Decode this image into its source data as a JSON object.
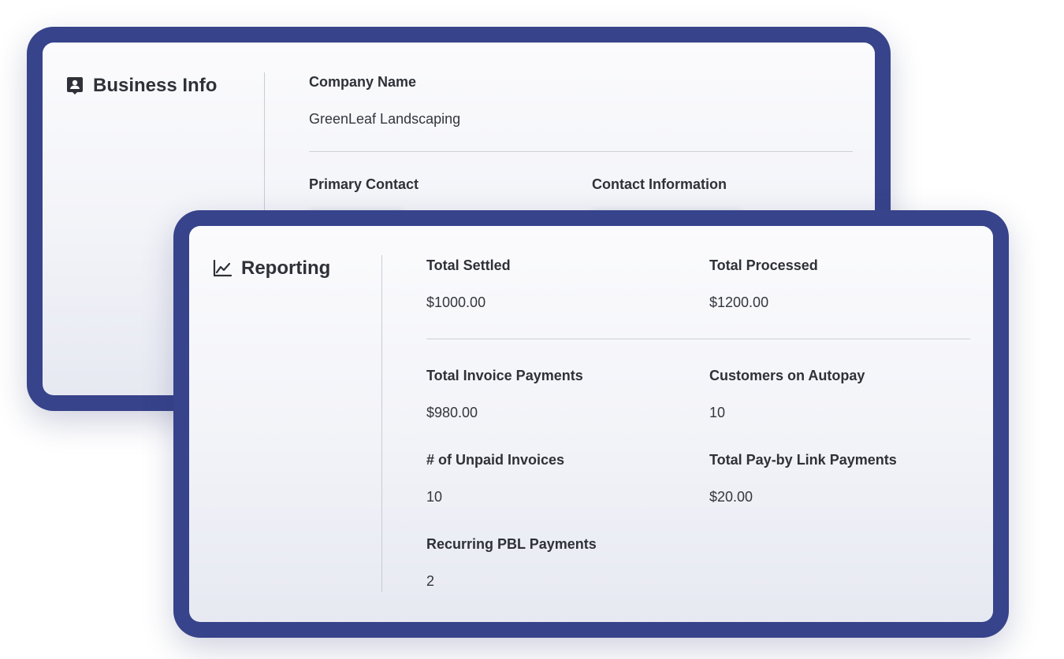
{
  "business_info": {
    "title": "Business Info",
    "icon": "contact-card-icon",
    "company_name_label": "Company Name",
    "company_name_value": "GreenLeaf Landscaping",
    "primary_contact_label": "Primary Contact",
    "contact_information_label": "Contact Information"
  },
  "reporting": {
    "title": "Reporting",
    "icon": "line-chart-icon",
    "metrics": [
      {
        "label": "Total Settled",
        "value": "$1000.00"
      },
      {
        "label": "Total Processed",
        "value": "$1200.00"
      },
      {
        "label": "Total Invoice Payments",
        "value": "$980.00"
      },
      {
        "label": "Customers on Autopay",
        "value": "10"
      },
      {
        "label": "# of Unpaid Invoices",
        "value": "10"
      },
      {
        "label": "Total Pay-by Link Payments",
        "value": "$20.00"
      },
      {
        "label": "Recurring PBL Payments",
        "value": "2"
      }
    ]
  },
  "colors": {
    "frame": "#37438a",
    "card_top": "#fbfbfd",
    "card_bottom": "#e7e9f2",
    "text": "#2f3138"
  }
}
